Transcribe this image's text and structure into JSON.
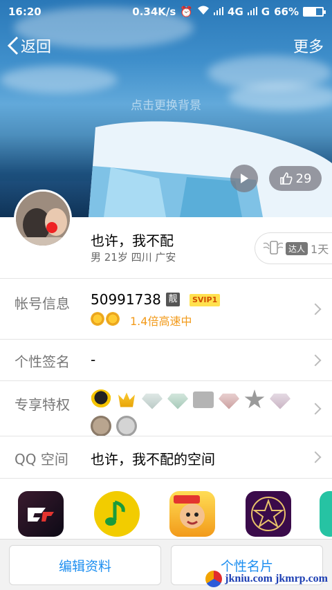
{
  "status_bar": {
    "time": "16:20",
    "net_speed": "0.34K/s",
    "network_1": "4G",
    "network_2": "G",
    "battery": "66%",
    "battery_level": 0.66
  },
  "nav": {
    "back_label": "返回",
    "more_label": "更多"
  },
  "cover": {
    "change_bg_label": "点击更换背景",
    "like_count": "29"
  },
  "profile": {
    "name": "也许，我不配",
    "meta": "男 21岁 四川 广安",
    "daren_tag": "达人",
    "daren_days": "1天"
  },
  "account": {
    "label": "帐号信息",
    "number": "50991738",
    "liang_badge": "靓",
    "svip_badge": "SVIP1",
    "speed_text": "1.4倍高速中"
  },
  "signature": {
    "label": "个性签名",
    "value": "-"
  },
  "privileges": {
    "label": "专享特权",
    "icons": [
      "qq-penguin-icon",
      "crown-lv-icon",
      "diamond-icon",
      "green-diamond-icon",
      "book-icon",
      "pink-diamond-icon",
      "star-icon",
      "purple-diamond-icon",
      "check-badge-icon",
      "lightning-badge-icon"
    ]
  },
  "qzone": {
    "label": "QQ 空间",
    "value": "也许，我不配的空间"
  },
  "apps": [
    "crossfire-app-icon",
    "qq-music-app-icon",
    "landlord-game-app-icon",
    "star-app-icon",
    "partial-app-icon"
  ],
  "bottom": {
    "edit_label": "编辑资料",
    "card_label": "个性名片"
  },
  "watermark": {
    "text": "jkniu.com jkmrp.com"
  },
  "colors": {
    "accent": "#1e8ff0",
    "speed": "#f29a1a",
    "svip_bg": "#ffe14f"
  }
}
